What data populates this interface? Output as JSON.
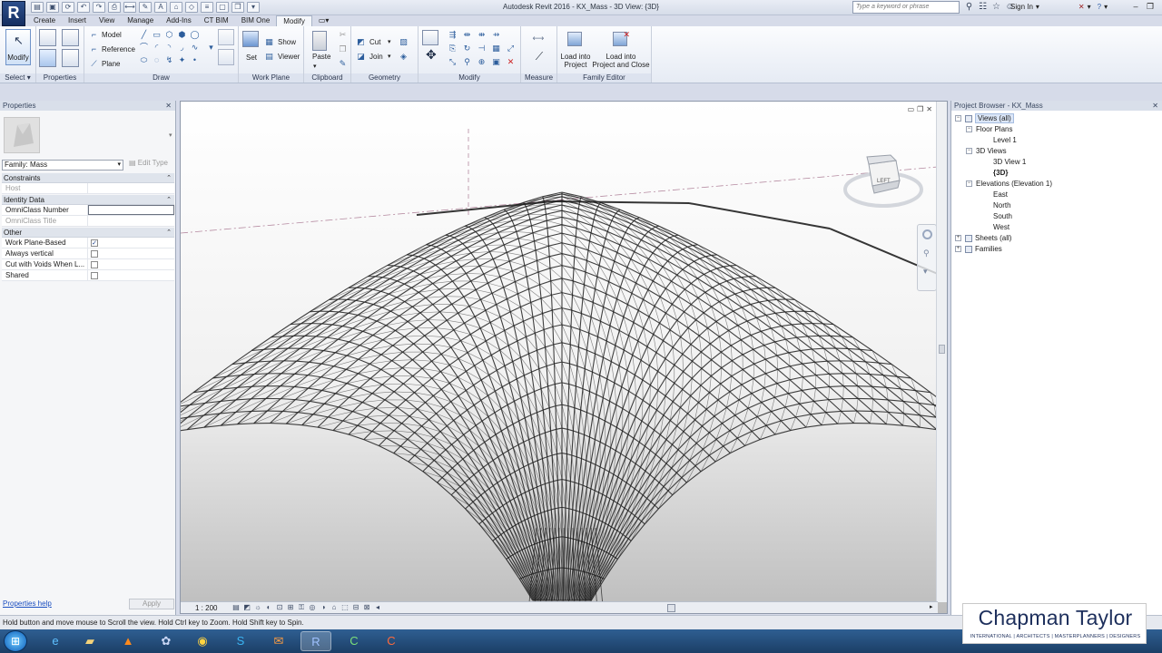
{
  "window": {
    "title": "Autodesk Revit 2016 -    KX_Mass - 3D View: {3D}",
    "search_placeholder": "Type a keyword or phrase",
    "sign_in": "Sign In"
  },
  "ribbon_tabs": [
    "Create",
    "Insert",
    "View",
    "Manage",
    "Add-Ins",
    "CT BIM",
    "BIM One",
    "Modify"
  ],
  "active_tab": "Modify",
  "ribbon": {
    "modify": "Modify",
    "select": "Select",
    "properties": "Properties",
    "draw_model": "Model",
    "draw_reference": "Reference",
    "draw_plane": "Plane",
    "draw": "Draw",
    "set": "Set",
    "show": "Show",
    "viewer": "Viewer",
    "work_plane": "Work Plane",
    "paste": "Paste",
    "clipboard": "Clipboard",
    "cut": "Cut",
    "join": "Join",
    "geometry": "Geometry",
    "modify_panel": "Modify",
    "measure": "Measure",
    "load_into": "Load into",
    "project": "Project",
    "load_into2": "Load into",
    "project_and_close": "Project and Close",
    "family_editor": "Family Editor"
  },
  "properties": {
    "title": "Properties",
    "family_selector": "Family: Mass",
    "edit_type": "Edit Type",
    "groups": {
      "constraints": "Constraints",
      "identity": "Identity Data",
      "other": "Other"
    },
    "rows": {
      "host": "Host",
      "omniclass_number": "OmniClass Number",
      "omniclass_title": "OmniClass Title",
      "work_plane_based": "Work Plane-Based",
      "always_vertical": "Always vertical",
      "cut_with_voids": "Cut with Voids When L...",
      "shared": "Shared"
    },
    "check_mark": "✓",
    "help_link": "Properties help",
    "apply": "Apply"
  },
  "viewport": {
    "viewcube_face": "LEFT",
    "scale": "1 : 200"
  },
  "browser": {
    "title": "Project Browser - KX_Mass",
    "views_all": "Views (all)",
    "floor_plans": "Floor Plans",
    "level1": "Level 1",
    "views_3d": "3D Views",
    "view3d1": "3D View 1",
    "view3d": "{3D}",
    "elevations": "Elevations (Elevation 1)",
    "east": "East",
    "north": "North",
    "south": "South",
    "west": "West",
    "sheets": "Sheets (all)",
    "families": "Families"
  },
  "status_bar": "Hold button and move mouse to Scroll the view. Hold Ctrl key to Zoom. Hold Shift key to Spin.",
  "watermark": {
    "name": "Chapman Taylor",
    "tagline": "INTERNATIONAL | ARCHITECTS | MASTERPLANNERS | DESIGNERS"
  },
  "colors": {
    "ribbon_bg": "#e6ebf4",
    "taskbar": "#1b3e66",
    "brand": "#1d2f5c"
  }
}
